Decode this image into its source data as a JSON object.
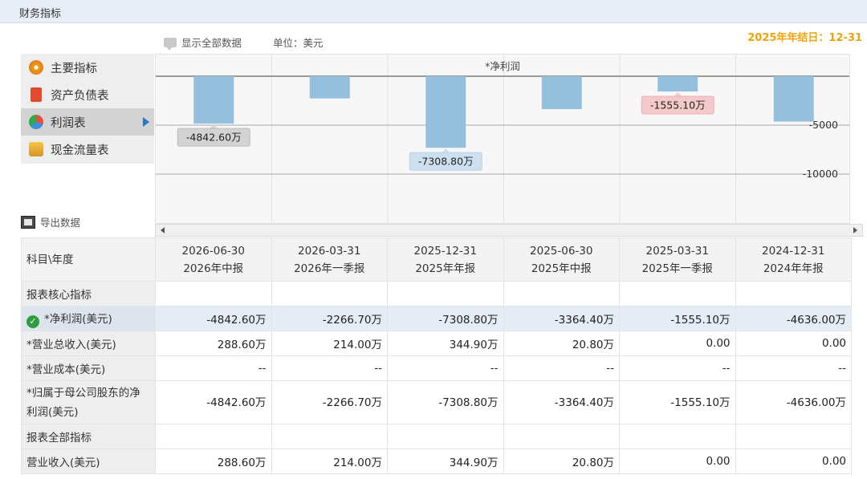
{
  "page": {
    "title": "财务指标"
  },
  "toolbar": {
    "show_all": "显示全部数据",
    "unit": "单位：美元",
    "fiscal_year_end": "2025年年结日：12-31"
  },
  "sidebar": {
    "items": [
      {
        "label": "主要指标",
        "icon": "gear-icon",
        "active": false
      },
      {
        "label": "资产负债表",
        "icon": "document-icon",
        "active": false
      },
      {
        "label": "利润表",
        "icon": "pie-icon",
        "active": true
      },
      {
        "label": "现金流量表",
        "icon": "coins-icon",
        "active": false
      }
    ],
    "export_label": "导出数据"
  },
  "colors": {
    "bar": "#94c0de",
    "accent": "#f0a30a",
    "label_gray": "#d3d3d3",
    "label_blue": "#cde0f0",
    "label_red": "#f3c9c9"
  },
  "chart_data": {
    "type": "bar",
    "title": "*净利润",
    "categories": [
      "2026-06-30",
      "2026-03-31",
      "2025-12-31",
      "2025-06-30",
      "2025-03-31",
      "2024-12-31"
    ],
    "series": [
      {
        "values": [
          -4842.6,
          -2266.7,
          -7308.8,
          -3364.4,
          -1555.1,
          -4636.0
        ]
      }
    ],
    "y_ticks": [
      "-5000",
      "-10000"
    ],
    "ylim": [
      -13500,
      0
    ],
    "data_labels": [
      {
        "index": 0,
        "text": "-4842.60万"
      },
      {
        "index": 2,
        "text": "-7308.80万"
      },
      {
        "index": 4,
        "text": "-1555.10万"
      }
    ],
    "grid": true,
    "axis_position": "right"
  },
  "table": {
    "corner": "科目\\年度",
    "periods": [
      {
        "date": "2026-06-30",
        "name": "2026年中报"
      },
      {
        "date": "2026-03-31",
        "name": "2026年一季报"
      },
      {
        "date": "2025-12-31",
        "name": "2025年年报"
      },
      {
        "date": "2025-06-30",
        "name": "2025年中报"
      },
      {
        "date": "2025-03-31",
        "name": "2025年一季报"
      },
      {
        "date": "2024-12-31",
        "name": "2024年年报"
      }
    ],
    "rows": [
      {
        "label": "报表核心指标",
        "section": true,
        "values": [
          "",
          "",
          "",
          "",
          "",
          ""
        ]
      },
      {
        "label": "*净利润(美元)",
        "selected": true,
        "values": [
          "-4842.60万",
          "-2266.70万",
          "-7308.80万",
          "-3364.40万",
          "-1555.10万",
          "-4636.00万"
        ]
      },
      {
        "label": "*营业总收入(美元)",
        "values": [
          "288.60万",
          "214.00万",
          "344.90万",
          "20.80万",
          "0.00",
          "0.00"
        ]
      },
      {
        "label": "*营业成本(美元)",
        "values": [
          "--",
          "--",
          "--",
          "--",
          "--",
          "--"
        ]
      },
      {
        "label": "*归属于母公司股东的净利润(美元)",
        "tall": true,
        "values": [
          "-4842.60万",
          "-2266.70万",
          "-7308.80万",
          "-3364.40万",
          "-1555.10万",
          "-4636.00万"
        ]
      },
      {
        "label": "报表全部指标",
        "section": true,
        "values": [
          "",
          "",
          "",
          "",
          "",
          ""
        ]
      },
      {
        "label": "营业收入(美元)",
        "values": [
          "288.60万",
          "214.00万",
          "344.90万",
          "20.80万",
          "0.00",
          "0.00"
        ]
      }
    ]
  }
}
